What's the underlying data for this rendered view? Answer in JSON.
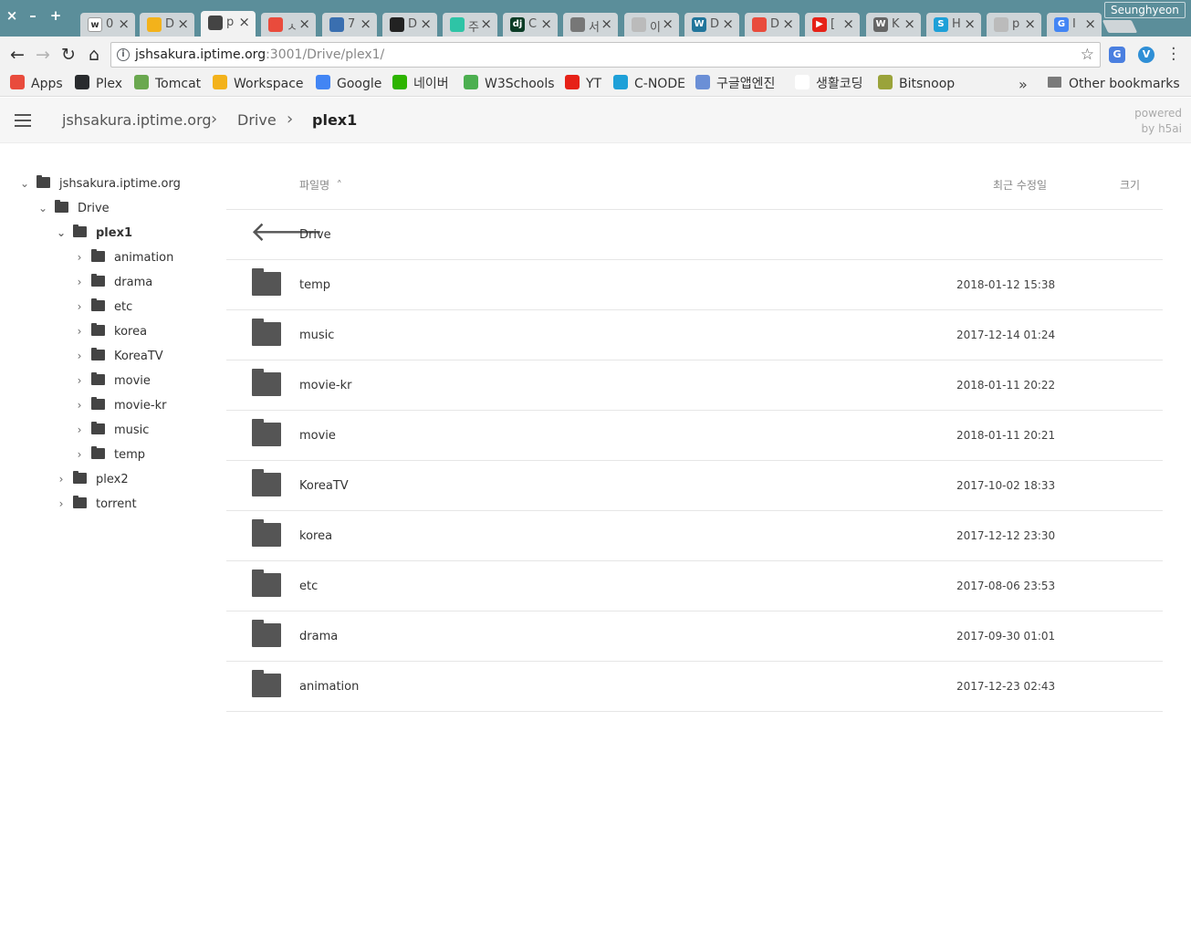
{
  "browser": {
    "window_controls": [
      "×",
      "–",
      "+"
    ],
    "profile_name": "Seunghyeon",
    "tabs": [
      {
        "icon": "wiki-icon",
        "text": "0",
        "color": "#ffffff",
        "glyph": "w"
      },
      {
        "icon": "pac-icon",
        "text": "D",
        "color": "#f3b21b",
        "glyph": ""
      },
      {
        "icon": "folder-icon",
        "text": "p",
        "color": "#444444",
        "glyph": "",
        "active": true
      },
      {
        "icon": "red-circle-icon",
        "text": "ㅅ",
        "color": "#e94b3c",
        "glyph": ""
      },
      {
        "icon": "window-icon",
        "text": "7",
        "color": "#3a6fb0",
        "glyph": ""
      },
      {
        "icon": "penguin-icon",
        "text": "D",
        "color": "#222222",
        "glyph": ""
      },
      {
        "icon": "green-circle-icon",
        "text": "주",
        "color": "#2ec4a6",
        "glyph": ""
      },
      {
        "icon": "django-icon",
        "text": "C",
        "color": "#0c3c26",
        "glyph": "dj"
      },
      {
        "icon": "book-icon",
        "text": "서",
        "color": "#777777",
        "glyph": ""
      },
      {
        "icon": "doc-icon",
        "text": "이",
        "color": "#bbbbbb",
        "glyph": ""
      },
      {
        "icon": "wordpress-icon",
        "text": "D",
        "color": "#21759b",
        "glyph": "W"
      },
      {
        "icon": "red-circle-icon",
        "text": "D",
        "color": "#e94b3c",
        "glyph": ""
      },
      {
        "icon": "youtube-icon",
        "text": "[",
        "color": "#e62117",
        "glyph": "▶"
      },
      {
        "icon": "wiki-w-icon",
        "text": "K",
        "color": "#666666",
        "glyph": "W"
      },
      {
        "icon": "s-icon",
        "text": "H",
        "color": "#1ea0d8",
        "glyph": "S"
      },
      {
        "icon": "doc-icon",
        "text": "p",
        "color": "#bbbbbb",
        "glyph": ""
      },
      {
        "icon": "google-icon",
        "text": "I",
        "color": "#4285f4",
        "glyph": "G"
      }
    ],
    "url_host": "jshsakura.iptime.org",
    "url_rest": ":3001/Drive/plex1/",
    "bookmarks": [
      {
        "label": "Apps",
        "icon": "apps-grid-icon",
        "color": "#e94b3c"
      },
      {
        "label": "Plex",
        "icon": "plex-icon",
        "color": "#282a2d"
      },
      {
        "label": "Tomcat",
        "icon": "tomcat-icon",
        "color": "#6aa84f"
      },
      {
        "label": "Workspace",
        "icon": "pac-icon",
        "color": "#f3b21b"
      },
      {
        "label": "Google",
        "icon": "google-icon",
        "color": "#4285f4"
      },
      {
        "label": "네이버",
        "icon": "naver-icon",
        "color": "#2db400"
      },
      {
        "label": "W3Schools",
        "icon": "w3schools-icon",
        "color": "#4caf50"
      },
      {
        "label": "YT",
        "icon": "youtube-icon",
        "color": "#e62117"
      },
      {
        "label": "C-NODE",
        "icon": "cnode-icon",
        "color": "#1ea0d8"
      },
      {
        "label": "구글앱엔진",
        "icon": "appengine-icon",
        "color": "#6b8fd6"
      },
      {
        "label": "생활코딩",
        "icon": "blank-icon",
        "color": "#ffffff"
      },
      {
        "label": "Bitsnoop",
        "icon": "bitsnoop-icon",
        "color": "#9aa33a"
      }
    ],
    "bookmarks_more": "»",
    "other_bookmarks": "Other bookmarks"
  },
  "breadcrumb": {
    "host": "jshsakura.iptime.org",
    "drive": "Drive",
    "current": "plex1"
  },
  "powered": {
    "line1": "powered",
    "line2": "by h5ai"
  },
  "tree": [
    {
      "label": "jshsakura.iptime.org",
      "chev": "⌄",
      "bold": false
    },
    {
      "label": "Drive",
      "chev": "⌄",
      "bold": false
    },
    {
      "label": "plex1",
      "chev": "⌄",
      "bold": true
    },
    {
      "label": "animation",
      "chev": "›",
      "bold": false
    },
    {
      "label": "drama",
      "chev": "›",
      "bold": false
    },
    {
      "label": "etc",
      "chev": "›",
      "bold": false
    },
    {
      "label": "korea",
      "chev": "›",
      "bold": false
    },
    {
      "label": "KoreaTV",
      "chev": "›",
      "bold": false
    },
    {
      "label": "movie",
      "chev": "›",
      "bold": false
    },
    {
      "label": "movie-kr",
      "chev": "›",
      "bold": false
    },
    {
      "label": "music",
      "chev": "›",
      "bold": false
    },
    {
      "label": "temp",
      "chev": "›",
      "bold": false
    },
    {
      "label": "plex2",
      "chev": "›",
      "bold": false
    },
    {
      "label": "torrent",
      "chev": "›",
      "bold": false
    }
  ],
  "list": {
    "header": {
      "name": "파일명",
      "sort_icon": "˄",
      "modified": "최근 수정일",
      "size": "크기"
    },
    "parent": {
      "label": "Drive"
    },
    "rows": [
      {
        "name": "temp",
        "date": "2018-01-12 15:38"
      },
      {
        "name": "music",
        "date": "2017-12-14 01:24"
      },
      {
        "name": "movie-kr",
        "date": "2018-01-11 20:22"
      },
      {
        "name": "movie",
        "date": "2018-01-11 20:21"
      },
      {
        "name": "KoreaTV",
        "date": "2017-10-02 18:33"
      },
      {
        "name": "korea",
        "date": "2017-12-12 23:30"
      },
      {
        "name": "etc",
        "date": "2017-08-06 23:53"
      },
      {
        "name": "drama",
        "date": "2017-09-30 01:01"
      },
      {
        "name": "animation",
        "date": "2017-12-23 02:43"
      }
    ]
  }
}
